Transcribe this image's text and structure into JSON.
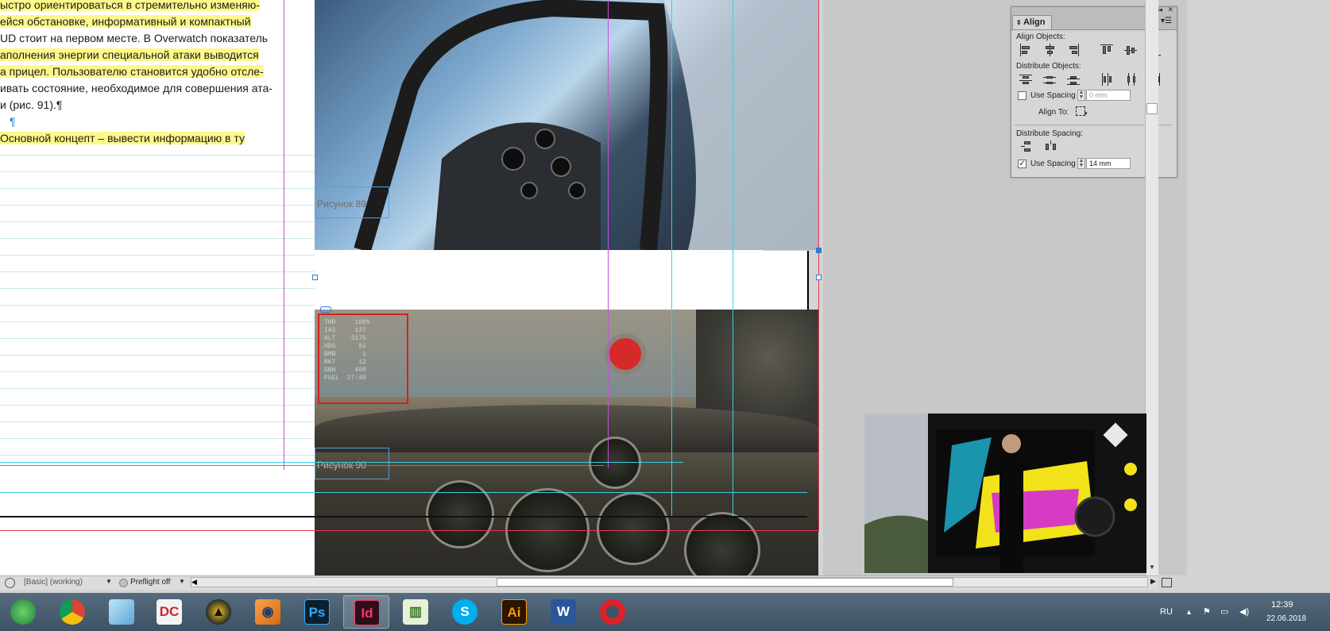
{
  "document": {
    "lines": [
      "ыстро ориентироваться в стремительно изменяю-",
      "ейся обстановке, информативный и компактный",
      "UD стоит на первом месте. В Overwatch показатель",
      "аполнения энергии специальной атаки выводится",
      "а прицел. Пользователю становится удобно отсле-",
      "ивать состояние, необходимое для совершения ата-",
      "и (рис. 91).¶",
      "¶",
      "  Основной концепт – вывести информацию в ту"
    ],
    "captions": {
      "top": "Рисунок 89",
      "bottom": "Рисунок 90"
    }
  },
  "hud": {
    "lines": "THR     100%\nIAS     137\nALT    3175\nHDG      91\nBMB       1\nRKT      12\nGNN     400\nFUEL  27:48"
  },
  "align_panel": {
    "title": "Align",
    "align_objects_label": "Align Objects:",
    "distribute_objects_label": "Distribute Objects:",
    "use_spacing_label": "Use Spacing",
    "spacing_value_top": "0 mm",
    "align_to_label": "Align To:",
    "distribute_spacing_label": "Distribute Spacing:",
    "use_spacing_label_2": "Use Spacing",
    "spacing_value_bottom": "14 mm",
    "use_spacing_top_checked": false,
    "use_spacing_bottom_checked": true
  },
  "status_bar": {
    "style": "[Basic] (working)",
    "preflight": "Preflight off"
  },
  "taskbar": {
    "apps": [
      "globe-app",
      "chrome",
      "notes-app",
      "dc-app",
      "warning-app",
      "eye-app",
      "photoshop",
      "indesign",
      "chart-app",
      "skype",
      "illustrator",
      "word",
      "opera"
    ],
    "language": "RU",
    "time": "12:39",
    "date": "22.06.2018"
  },
  "colors": {
    "accent_indesign": "#ff3366",
    "guide_cyan": "#3ad0e4",
    "guide_magenta": "#c54fd8",
    "highlight": "#fff88a"
  }
}
